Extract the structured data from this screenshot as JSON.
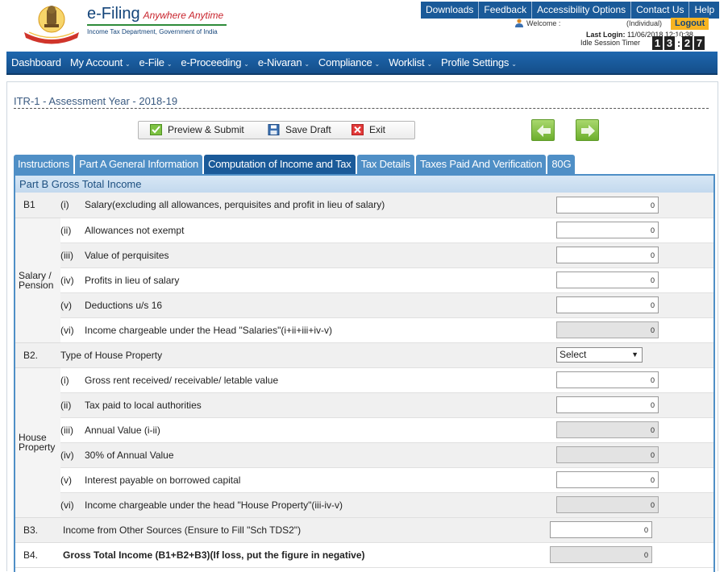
{
  "header": {
    "logo_main": "e-Filing",
    "logo_tagline": "Anywhere Anytime",
    "logo_sub": "Income Tax Department, Government of India",
    "top_links": [
      "Downloads",
      "Feedback",
      "Accessibility Options",
      "Contact Us",
      "Help"
    ],
    "welcome": "Welcome :",
    "user_type": "(Individual)",
    "logout": "Logout",
    "last_login_label": "Last Login:",
    "last_login_value": "11/06/2018 12:10:38",
    "idle_label": "Idle Session Timer",
    "idle_digits": [
      "1",
      "3",
      ":",
      "2",
      "7"
    ]
  },
  "nav": [
    "Dashboard",
    "My Account",
    "e-File",
    "e-Proceeding",
    "e-Nivaran",
    "Compliance",
    "Worklist",
    "Profile Settings"
  ],
  "nav_caret": "⌄",
  "form": {
    "title": "ITR-1 - Assessment Year - 2018-19",
    "preview": "Preview & Submit",
    "save": "Save Draft",
    "exit": "Exit"
  },
  "tabs": [
    "Instructions",
    "Part A General Information",
    "Computation of Income and Tax",
    "Tax Details",
    "Taxes Paid And Verification",
    "80G"
  ],
  "active_tab": 2,
  "panel": {
    "heading": "Part B Gross Total Income",
    "b1": "B1",
    "salary_group": "Salary / Pension",
    "salary_rows": [
      {
        "num": "(i)",
        "label": "Salary(excluding all allowances, perquisites and profit in lieu of salary)",
        "value": "0"
      },
      {
        "num": "(ii)",
        "label": "Allowances not exempt",
        "value": "0"
      },
      {
        "num": "(iii)",
        "label": "Value of perquisites",
        "value": "0"
      },
      {
        "num": "(iv)",
        "label": "Profits in lieu of salary",
        "value": "0"
      },
      {
        "num": "(v)",
        "label": "Deductions u/s 16",
        "value": "0"
      },
      {
        "num": "(vi)",
        "label": "Income chargeable under the Head \"Salaries\"(i+ii+iii+iv-v)",
        "value": "0"
      }
    ],
    "b2": "B2.",
    "b2_label": "Type of House Property",
    "b2_select": "Select",
    "house_group": "House Property",
    "house_rows": [
      {
        "num": "(i)",
        "label": "Gross rent received/ receivable/ letable value",
        "value": "0"
      },
      {
        "num": "(ii)",
        "label": "Tax paid to local authorities",
        "value": "0"
      },
      {
        "num": "(iii)",
        "label": "Annual Value (i-ii)",
        "value": "0"
      },
      {
        "num": "(iv)",
        "label": "30% of Annual Value",
        "value": "0"
      },
      {
        "num": "(v)",
        "label": "Interest payable on borrowed capital",
        "value": "0"
      },
      {
        "num": "(vi)",
        "label": "Income chargeable under the head \"House Property\"(iii-iv-v)",
        "value": "0"
      }
    ],
    "b3": "B3.",
    "b3_label": "Income from Other Sources (Ensure to Fill \"Sch TDS2\")",
    "b3_value": "0",
    "b4": "B4.",
    "b4_label": "Gross Total Income (B1+B2+B3)(If loss, put the figure in negative)",
    "b4_value": "0"
  },
  "colors": {
    "nav_blue": "#1a5a99",
    "tab_blue": "#4f8fc6",
    "logout_yellow": "#f7b422",
    "arrow_green": "#7ab93a"
  }
}
